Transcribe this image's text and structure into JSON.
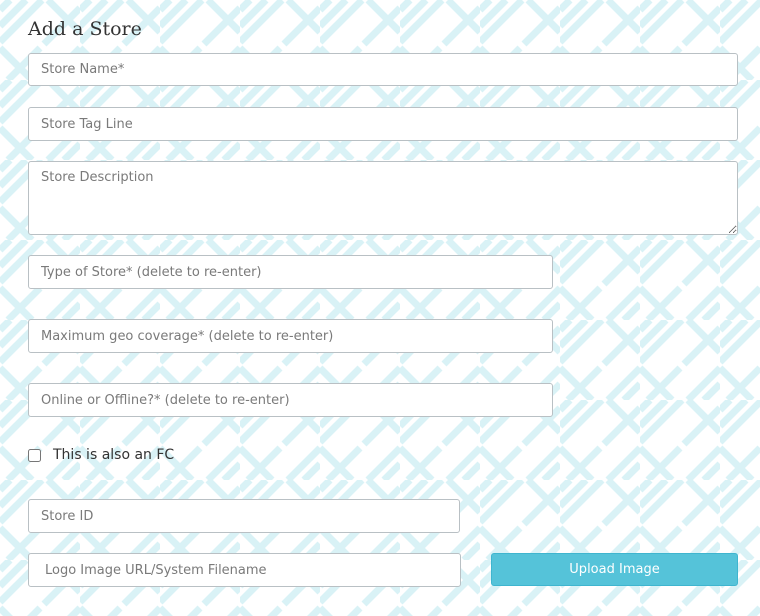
{
  "page": {
    "title": "Add a Store"
  },
  "form": {
    "store_name_placeholder": "Store Name*",
    "store_tag_line_placeholder": "Store Tag Line",
    "store_description_placeholder": "Store Description",
    "type_of_store_placeholder": "Type of Store* (delete to re-enter)",
    "geo_coverage_placeholder": "Maximum geo coverage* (delete to re-enter)",
    "online_offline_placeholder": "Online or Offline?* (delete to re-enter)",
    "fc_checkbox_label": "This is also an FC",
    "fc_checkbox_checked": false,
    "store_id_placeholder": "Store ID",
    "logo_url_placeholder": "Logo Image URL/System Filename",
    "upload_button_label": "Upload Image"
  },
  "colors": {
    "pattern": "#d9f2f6",
    "button_bg": "#55c3d9",
    "field_border": "#b9c0c4"
  }
}
